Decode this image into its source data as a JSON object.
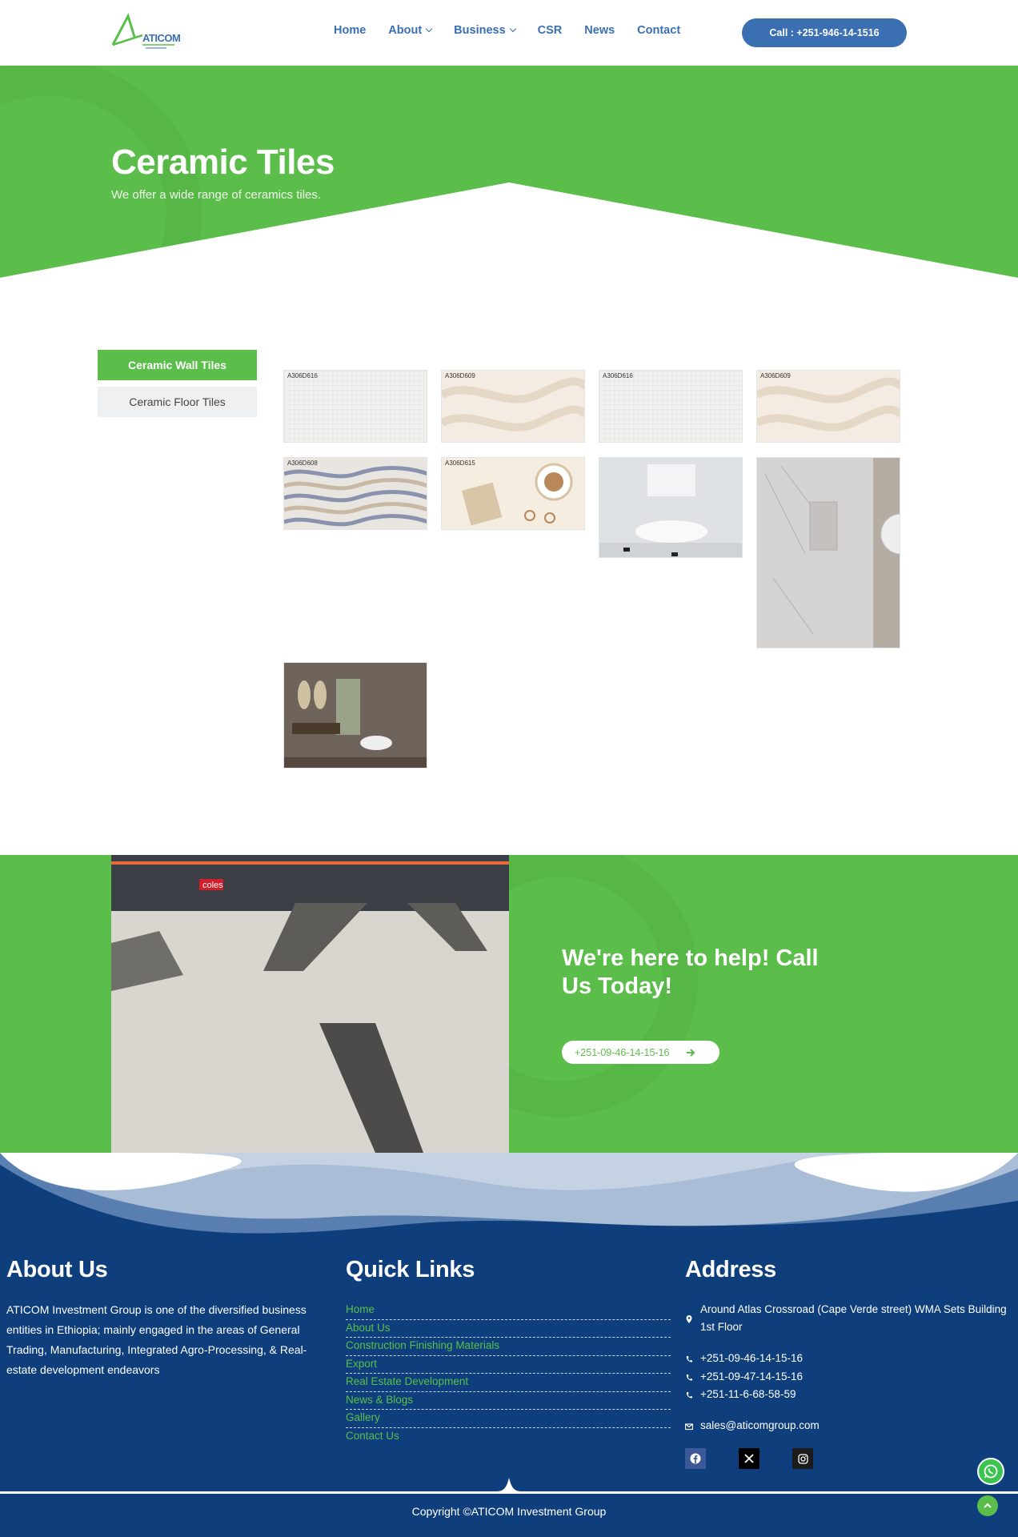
{
  "header": {
    "logo_text": "ATICOM",
    "nav": [
      {
        "label": "Home",
        "dropdown": false
      },
      {
        "label": "About",
        "dropdown": true
      },
      {
        "label": "Business",
        "dropdown": true
      },
      {
        "label": "CSR",
        "dropdown": false
      },
      {
        "label": "News",
        "dropdown": false
      },
      {
        "label": "Contact",
        "dropdown": false
      }
    ],
    "call_button": "Call : +251-946-14-1516"
  },
  "hero": {
    "title": "Ceramic Tiles",
    "subtitle": "We offer a wide range of ceramics tiles."
  },
  "tabs": {
    "active": "Ceramic Wall Tiles",
    "inactive": "Ceramic Floor Tiles"
  },
  "gallery": {
    "items": [
      {
        "code": "A306D616",
        "kind": "grid-light"
      },
      {
        "code": "A306D609",
        "kind": "wave-beige"
      },
      {
        "code": "A306D616",
        "kind": "grid-light"
      },
      {
        "code": "A306D609",
        "kind": "wave-beige"
      },
      {
        "code": "A306D608",
        "kind": "wave-blue"
      },
      {
        "code": "A306D615",
        "kind": "coffee"
      },
      {
        "code": "",
        "kind": "bathroom-white"
      },
      {
        "code": "",
        "kind": "shower-marble"
      },
      {
        "code": "",
        "kind": "bathroom-grey"
      }
    ]
  },
  "cta": {
    "title": "We're here to help! Call Us Today!",
    "phone_button": "+251-09-46-14-15-16",
    "photo_sign": "coles"
  },
  "footer": {
    "about_heading": "About Us",
    "about_text": "ATICOM Investment Group is one of the diversified business entities in Ethiopia; mainly engaged in the areas of General Trading, Manufacturing, Integrated Agro-Processing, & Real-estate development endeavors",
    "links_heading": "Quick Links",
    "links": [
      "Home",
      "About Us",
      "Construction Finishing Materials",
      "Export",
      "Real Estate Development",
      "News & Blogs",
      "Gallery",
      "Contact Us"
    ],
    "address_heading": "Address",
    "address": "Around Atlas Crossroad (Cape Verde street) WMA Sets Building 1st Floor",
    "phones": [
      "+251-09-46-14-15-16",
      "+251-09-47-14-15-16",
      "+251-11-6-68-58-59"
    ],
    "email": "sales@aticomgroup.com",
    "social_icons": [
      "facebook-icon",
      "x-twitter-icon",
      "instagram-icon"
    ],
    "copyright": "Copyright ©ATICOM Investment Group"
  },
  "colors": {
    "green": "#5bbe4a",
    "blue": "#3a6fb2",
    "navy": "#0e3f7c"
  }
}
